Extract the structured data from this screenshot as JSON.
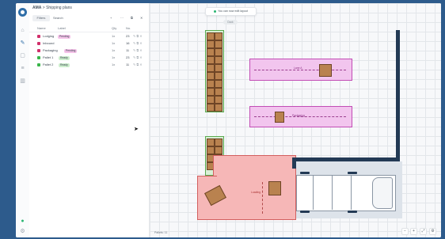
{
  "breadcrumb": {
    "project": "AMA",
    "separator": ">",
    "page": "Shipping plans"
  },
  "toolbar": {
    "filter_label": "Filters",
    "search_label": "Search",
    "add": "+",
    "more": "⋯"
  },
  "columns": {
    "name": "Name",
    "label": "Label",
    "qty": "Qty",
    "count": "No."
  },
  "rows": [
    {
      "color": "#d12f6b",
      "name": "Lodging",
      "tag": "Pending",
      "tag_color": "#f4c2e8",
      "qty": "1x",
      "count": "23"
    },
    {
      "color": "#d12f6b",
      "name": "Inbound",
      "tag": "",
      "tag_color": "",
      "qty": "1x",
      "count": "16"
    },
    {
      "color": "#d12f6b",
      "name": "Packaging",
      "tag": "Pending",
      "tag_color": "#f4c2e8",
      "qty": "1x",
      "count": "11"
    },
    {
      "color": "#39b54a",
      "name": "Pallet 1",
      "tag": "Ready",
      "tag_color": "#cdeecd",
      "qty": "1x",
      "count": "23"
    },
    {
      "color": "#39b54a",
      "name": "Pallet 2",
      "tag": "Ready",
      "tag_color": "#cdeecd",
      "qty": "1x",
      "count": "11"
    }
  ],
  "canvas": {
    "toast": "You can now edit layout",
    "pill": "Dock",
    "lane_top_label": "Lane A",
    "lane_mid_label": "Packaging",
    "zone_label": "Loading",
    "status": "Pallets: 11",
    "zoom_out": "−",
    "zoom_in": "+"
  }
}
